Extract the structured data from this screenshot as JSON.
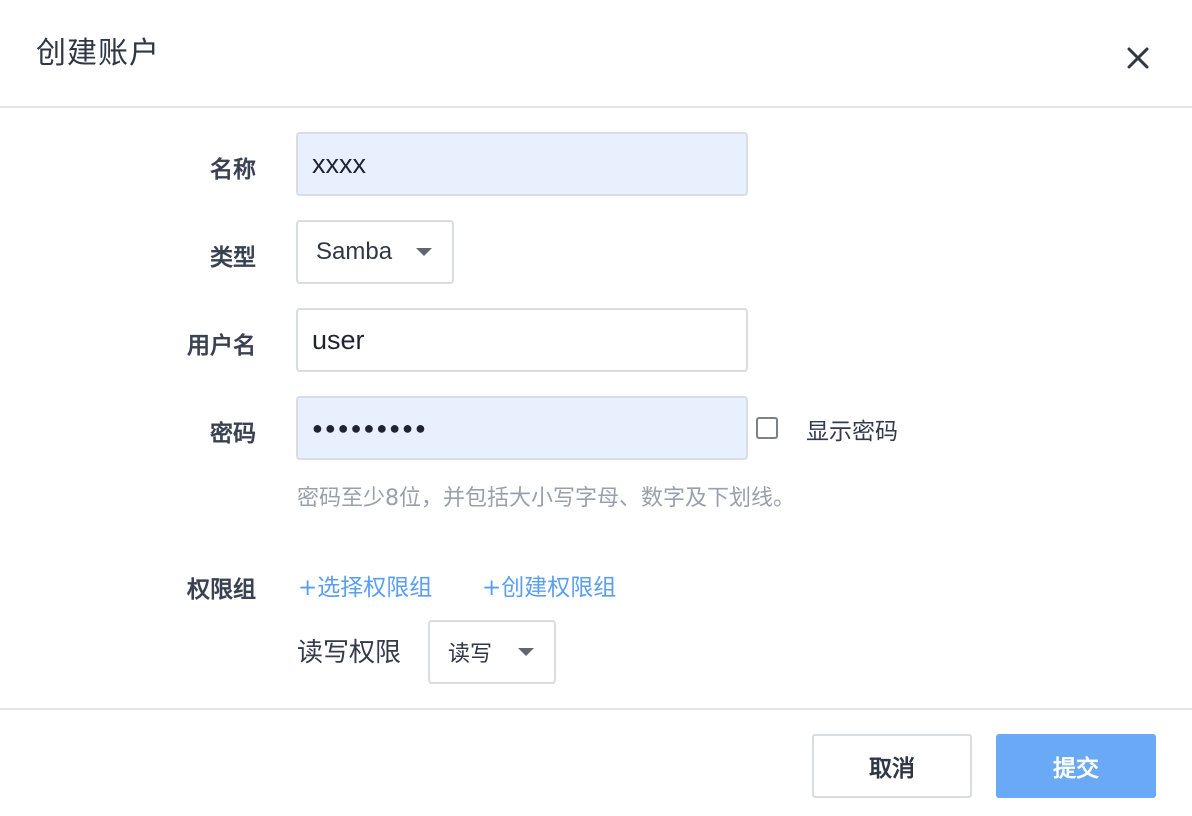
{
  "dialog": {
    "title": "创建账户"
  },
  "form": {
    "name": {
      "label": "名称",
      "value": "xxxx"
    },
    "type": {
      "label": "类型",
      "value": "Samba"
    },
    "username": {
      "label": "用户名",
      "value": "user"
    },
    "password": {
      "label": "密码",
      "value": "●●●●●●●●●",
      "show_label": "显示密码",
      "hint": "密码至少8位，并包括大小写字母、数字及下划线。"
    },
    "permission_group": {
      "label": "权限组",
      "select_link": "+选择权限组",
      "create_link": "+创建权限组",
      "rw_label": "读写权限",
      "rw_value": "读写"
    }
  },
  "footer": {
    "cancel": "取消",
    "submit": "提交"
  },
  "colors": {
    "accent": "#5a9ef0",
    "submit_bg": "#6aa9f5",
    "filled_input_bg": "#e8effd"
  }
}
